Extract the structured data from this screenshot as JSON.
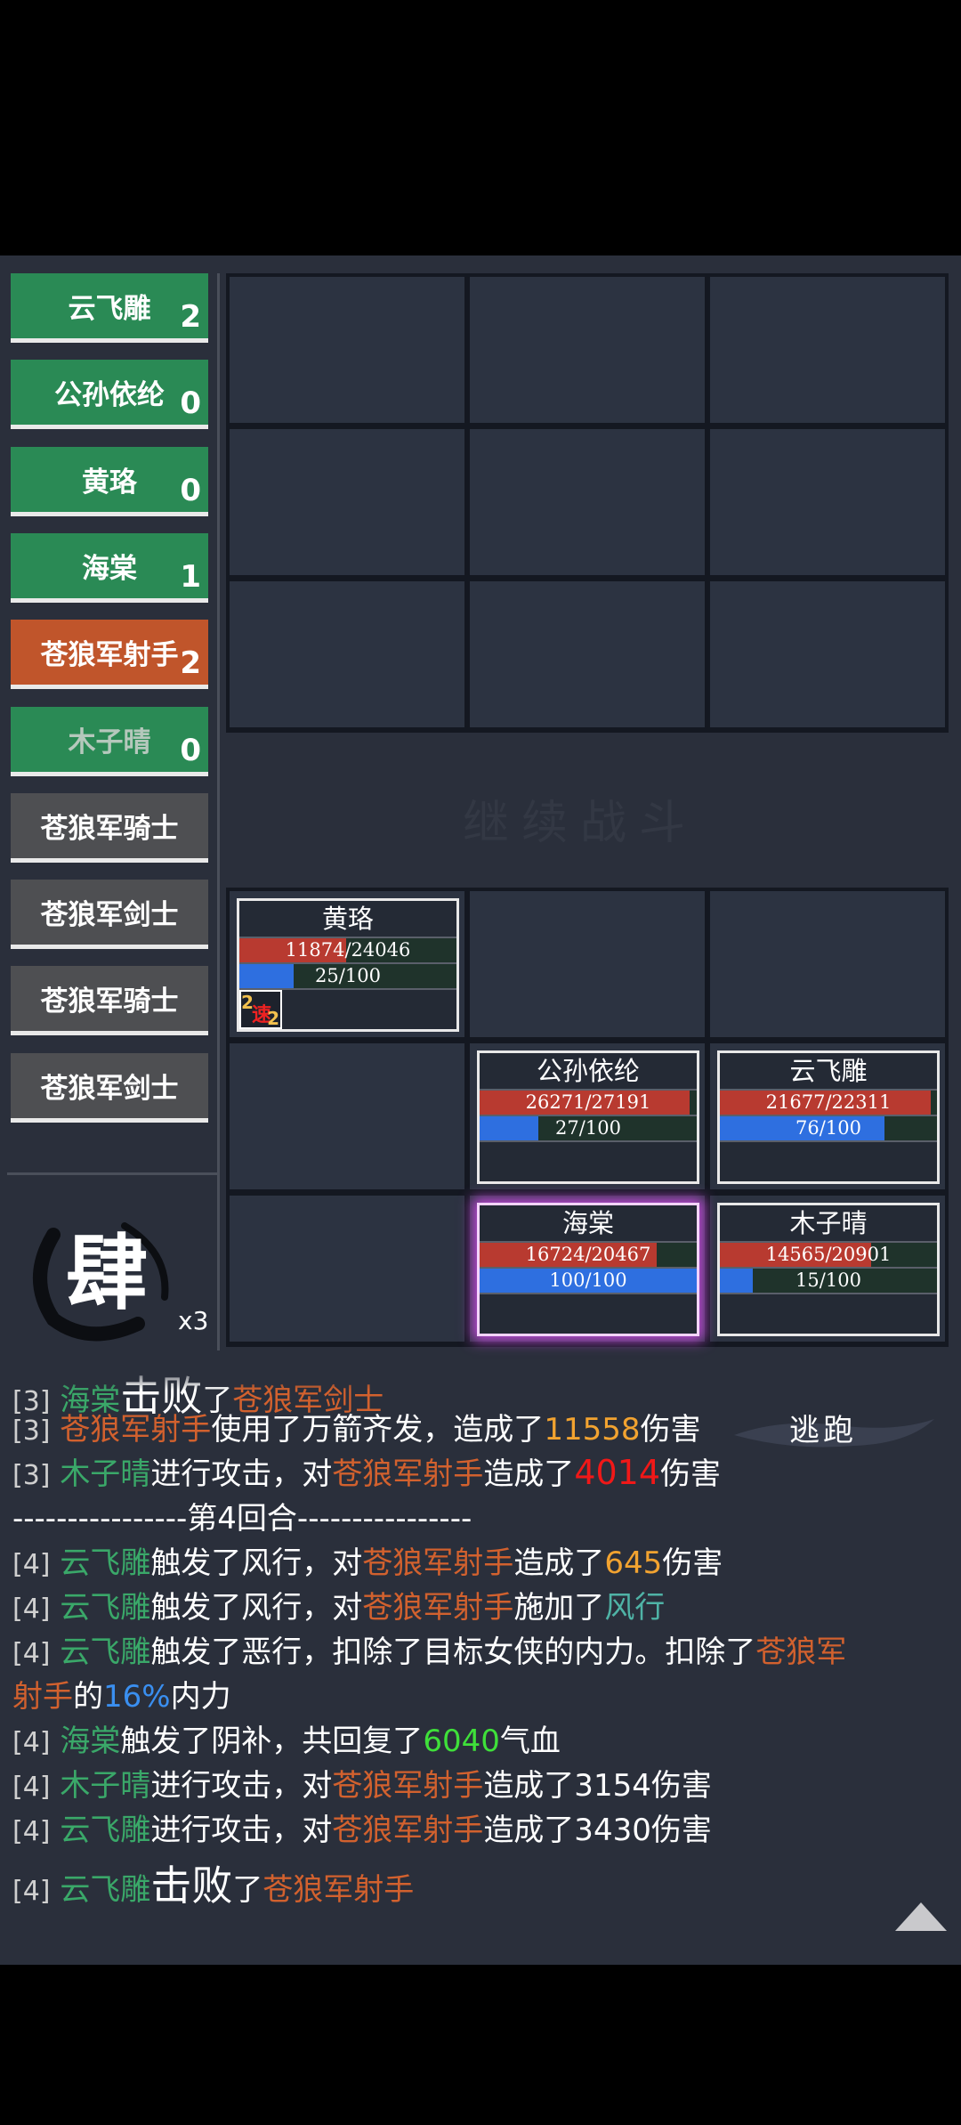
{
  "turn_order": [
    {
      "name": "云飞雕",
      "count": "2",
      "side": "ally"
    },
    {
      "name": "公孙依纶",
      "count": "0",
      "side": "ally"
    },
    {
      "name": "黄珞",
      "count": "0",
      "side": "ally"
    },
    {
      "name": "海棠",
      "count": "1",
      "side": "ally"
    },
    {
      "name": "苍狼军射手",
      "count": "2",
      "side": "enemy-active"
    },
    {
      "name": "木子晴",
      "count": "0",
      "side": "ally"
    },
    {
      "name": "苍狼军骑士",
      "count": "",
      "side": "enemy"
    },
    {
      "name": "苍狼军剑士",
      "count": "",
      "side": "enemy"
    },
    {
      "name": "苍狼军骑士",
      "count": "",
      "side": "enemy"
    },
    {
      "name": "苍狼军剑士",
      "count": "",
      "side": "enemy"
    }
  ],
  "seal": {
    "glyph": "肆",
    "multiplier": "x3"
  },
  "continue_text": "继续战斗",
  "units": {
    "huangluo": {
      "name": "黄珞",
      "hp": 11874,
      "hp_max": 24046,
      "hp_text": "11874/24046",
      "mp": 25,
      "mp_text": "25/100",
      "buff": {
        "left": "2",
        "glyph": "速",
        "right": "2"
      }
    },
    "gongsun": {
      "name": "公孙依纶",
      "hp": 26271,
      "hp_max": 27191,
      "hp_text": "26271/27191",
      "mp": 27,
      "mp_text": "27/100"
    },
    "yunfeidiao": {
      "name": "云飞雕",
      "hp": 21677,
      "hp_max": 22311,
      "hp_text": "21677/22311",
      "mp": 76,
      "mp_text": "76/100"
    },
    "haitang": {
      "name": "海棠",
      "hp": 16724,
      "hp_max": 20467,
      "hp_text": "16724/20467",
      "mp": 100,
      "mp_text": "100/100"
    },
    "muziqing": {
      "name": "木子晴",
      "hp": 14565,
      "hp_max": 20901,
      "hp_text": "14565/20901",
      "mp": 15,
      "mp_text": "15/100"
    }
  },
  "log": {
    "l0": {
      "tag": "[3]",
      "a": "海棠",
      "b": "击败",
      "c": "了",
      "d": "苍狼军剑士"
    },
    "l1": {
      "tag": "[3]",
      "a": "苍狼军射手",
      "b": "使用了万箭齐发，造成了",
      "c": "11558",
      "d": "伤害"
    },
    "l2": {
      "tag": "[3]",
      "a": "木子晴",
      "b": "进行攻击，对",
      "c": "苍狼军射手",
      "d": "造成了",
      "e": "4014",
      "f": "伤害"
    },
    "l3": {
      "text": "----------------第4回合----------------"
    },
    "l4": {
      "tag": "[4]",
      "a": "云飞雕",
      "b": "触发了风行，对",
      "c": "苍狼军射手",
      "d": "造成了",
      "e": "645",
      "f": "伤害"
    },
    "l5": {
      "tag": "[4]",
      "a": "云飞雕",
      "b": "触发了风行，对",
      "c": "苍狼军射手",
      "d": "施加了",
      "e": "风行"
    },
    "l6": {
      "tag": "[4]",
      "a": "云飞雕",
      "b": "触发了恶行，扣除了目标女侠的内力。扣除了",
      "c": "苍狼军"
    },
    "l7": {
      "a": "射手",
      "b": "的",
      "c": "16%",
      "d": "内力"
    },
    "l8": {
      "tag": "[4]",
      "a": "海棠",
      "b": "触发了阴补，共回复了",
      "c": "6040",
      "d": "气血"
    },
    "l9": {
      "tag": "[4]",
      "a": "木子晴",
      "b": "进行攻击，对",
      "c": "苍狼军射手",
      "d": "造成了3154伤害"
    },
    "l10": {
      "tag": "[4]",
      "a": "云飞雕",
      "b": "进行攻击，对",
      "c": "苍狼军射手",
      "d": "造成了3430伤害"
    },
    "l11": {
      "tag": "[4]",
      "a": "云飞雕",
      "b": "击败",
      "c": "了",
      "d": "苍狼军射手"
    }
  },
  "flee_label": "逃跑",
  "colors": {
    "ally": "#2a8a55",
    "enemy_active": "#c0552b",
    "enemy": "#4e4f52",
    "hp": "#b83a30",
    "mp": "#2e6fe0"
  }
}
